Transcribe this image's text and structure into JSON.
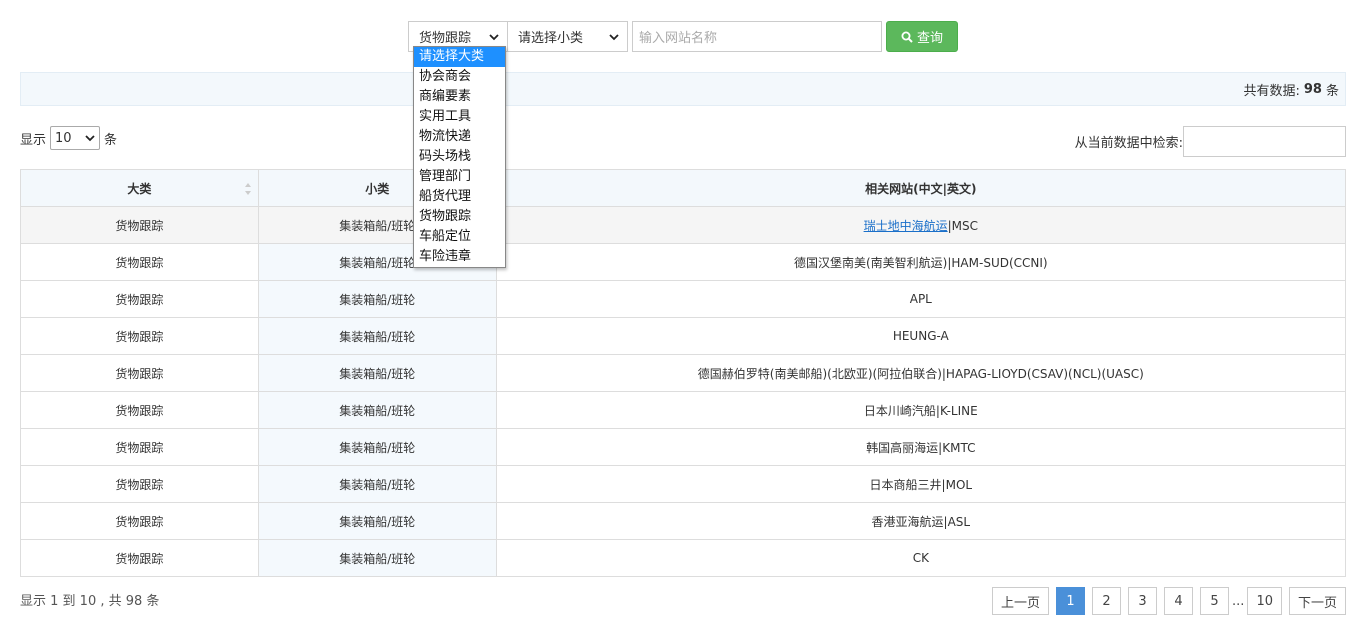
{
  "search": {
    "category_value": "货物跟踪",
    "subcategory_value": "请选择小类",
    "site_placeholder": "输入网站名称",
    "query_label": "查询"
  },
  "dropdown": {
    "items": [
      "请选择大类",
      "协会商会",
      "商编要素",
      "实用工具",
      "物流快递",
      "码头场栈",
      "管理部门",
      "船货代理",
      "货物跟踪",
      "车船定位",
      "车险违章"
    ],
    "active_index": 0
  },
  "info": {
    "total_prefix": "共有数据:",
    "total_count": "98",
    "total_suffix": "条"
  },
  "length": {
    "prefix": "显示",
    "value": "10",
    "suffix": "条"
  },
  "filter": {
    "label": "从当前数据中检索:"
  },
  "table": {
    "headers": [
      "大类",
      "小类",
      "相关网站(中文|英文)"
    ],
    "rows": [
      {
        "cat": "货物跟踪",
        "sub": "集装箱船/班轮",
        "site_cn": "瑞士地中海航运",
        "site_en": "|MSC"
      },
      {
        "cat": "货物跟踪",
        "sub": "集装箱船/班轮",
        "site_cn": "",
        "site_en": "德国汉堡南美(南美智利航运)|HAM-SUD(CCNI)"
      },
      {
        "cat": "货物跟踪",
        "sub": "集装箱船/班轮",
        "site_cn": "",
        "site_en": "APL"
      },
      {
        "cat": "货物跟踪",
        "sub": "集装箱船/班轮",
        "site_cn": "",
        "site_en": "HEUNG-A"
      },
      {
        "cat": "货物跟踪",
        "sub": "集装箱船/班轮",
        "site_cn": "",
        "site_en": "德国赫伯罗特(南美邮船)(北欧亚)(阿拉伯联合)|HAPAG-LIOYD(CSAV)(NCL)(UASC)"
      },
      {
        "cat": "货物跟踪",
        "sub": "集装箱船/班轮",
        "site_cn": "",
        "site_en": "日本川崎汽船|K-LINE"
      },
      {
        "cat": "货物跟踪",
        "sub": "集装箱船/班轮",
        "site_cn": "",
        "site_en": "韩国高丽海运|KMTC"
      },
      {
        "cat": "货物跟踪",
        "sub": "集装箱船/班轮",
        "site_cn": "",
        "site_en": "日本商船三井|MOL"
      },
      {
        "cat": "货物跟踪",
        "sub": "集装箱船/班轮",
        "site_cn": "",
        "site_en": "香港亚海航运|ASL"
      },
      {
        "cat": "货物跟踪",
        "sub": "集装箱船/班轮",
        "site_cn": "",
        "site_en": "CK"
      }
    ]
  },
  "footer": {
    "summary": "显示 1 到 10 , 共 98 条",
    "prev": "上一页",
    "next": "下一页",
    "pages": [
      "1",
      "2",
      "3",
      "4",
      "5"
    ],
    "ellipsis": "...",
    "last_page": "10",
    "active_page": "1"
  },
  "colors": {
    "query_button": "#5cb85c",
    "active_page": "#4a90d9",
    "dropdown_active": "#1e90ff",
    "link": "#1a6fc9"
  },
  "icons": {
    "query": "search-icon",
    "select": "chevron-down-icon",
    "sort": "sort-icon"
  }
}
